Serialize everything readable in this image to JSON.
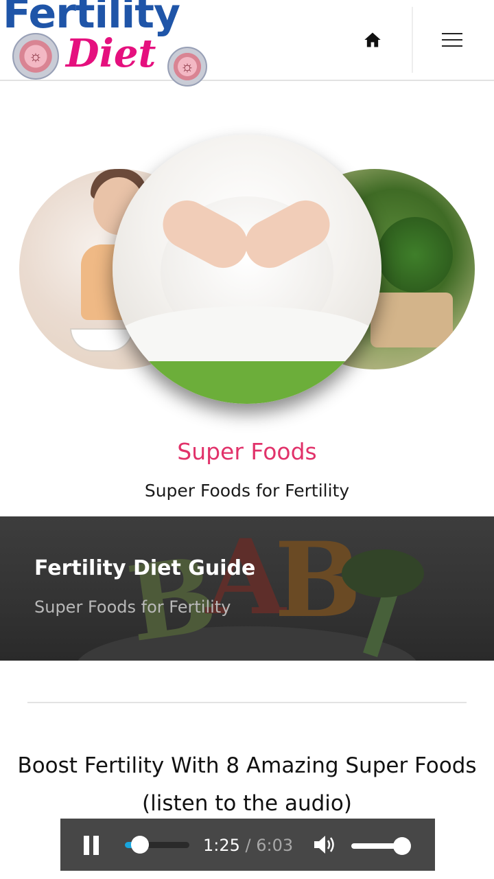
{
  "header": {
    "logo_line1": "Fertility",
    "logo_line2": "Diet",
    "home_icon": "home-icon",
    "menu_icon": "hamburger-menu-icon"
  },
  "hero": {
    "images": [
      "woman-eating-photo",
      "pregnant-belly-photo",
      "broccoli-photo"
    ]
  },
  "section": {
    "title": "Super Foods",
    "subtitle": "Super Foods for Fertility"
  },
  "banner": {
    "title": "Fertility Diet Guide",
    "subtitle": "Super Foods for Fertility"
  },
  "article": {
    "title_line1": "Boost Fertility With 8 Amazing Super Foods",
    "title_line2": "(listen to the audio)"
  },
  "player": {
    "state_icon": "pause-icon",
    "current_time": "1:25",
    "separator": " / ",
    "total_time": "6:03",
    "progress_fraction": 0.235,
    "volume_fraction": 0.9
  },
  "colors": {
    "brand_blue": "#1f55a8",
    "brand_pink": "#e5107e",
    "title_pink": "#e1326a",
    "player_bg": "#474747",
    "progress_accent": "#19a5dd"
  }
}
